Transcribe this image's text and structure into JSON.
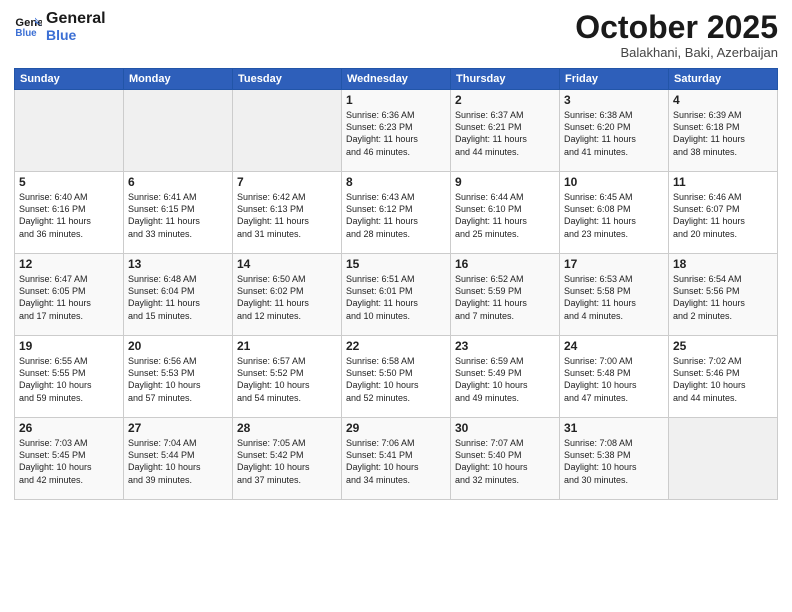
{
  "logo": {
    "line1": "General",
    "line2": "Blue"
  },
  "title": "October 2025",
  "subtitle": "Balakhani, Baki, Azerbaijan",
  "days_header": [
    "Sunday",
    "Monday",
    "Tuesday",
    "Wednesday",
    "Thursday",
    "Friday",
    "Saturday"
  ],
  "weeks": [
    [
      {
        "day": "",
        "info": ""
      },
      {
        "day": "",
        "info": ""
      },
      {
        "day": "",
        "info": ""
      },
      {
        "day": "1",
        "info": "Sunrise: 6:36 AM\nSunset: 6:23 PM\nDaylight: 11 hours\nand 46 minutes."
      },
      {
        "day": "2",
        "info": "Sunrise: 6:37 AM\nSunset: 6:21 PM\nDaylight: 11 hours\nand 44 minutes."
      },
      {
        "day": "3",
        "info": "Sunrise: 6:38 AM\nSunset: 6:20 PM\nDaylight: 11 hours\nand 41 minutes."
      },
      {
        "day": "4",
        "info": "Sunrise: 6:39 AM\nSunset: 6:18 PM\nDaylight: 11 hours\nand 38 minutes."
      }
    ],
    [
      {
        "day": "5",
        "info": "Sunrise: 6:40 AM\nSunset: 6:16 PM\nDaylight: 11 hours\nand 36 minutes."
      },
      {
        "day": "6",
        "info": "Sunrise: 6:41 AM\nSunset: 6:15 PM\nDaylight: 11 hours\nand 33 minutes."
      },
      {
        "day": "7",
        "info": "Sunrise: 6:42 AM\nSunset: 6:13 PM\nDaylight: 11 hours\nand 31 minutes."
      },
      {
        "day": "8",
        "info": "Sunrise: 6:43 AM\nSunset: 6:12 PM\nDaylight: 11 hours\nand 28 minutes."
      },
      {
        "day": "9",
        "info": "Sunrise: 6:44 AM\nSunset: 6:10 PM\nDaylight: 11 hours\nand 25 minutes."
      },
      {
        "day": "10",
        "info": "Sunrise: 6:45 AM\nSunset: 6:08 PM\nDaylight: 11 hours\nand 23 minutes."
      },
      {
        "day": "11",
        "info": "Sunrise: 6:46 AM\nSunset: 6:07 PM\nDaylight: 11 hours\nand 20 minutes."
      }
    ],
    [
      {
        "day": "12",
        "info": "Sunrise: 6:47 AM\nSunset: 6:05 PM\nDaylight: 11 hours\nand 17 minutes."
      },
      {
        "day": "13",
        "info": "Sunrise: 6:48 AM\nSunset: 6:04 PM\nDaylight: 11 hours\nand 15 minutes."
      },
      {
        "day": "14",
        "info": "Sunrise: 6:50 AM\nSunset: 6:02 PM\nDaylight: 11 hours\nand 12 minutes."
      },
      {
        "day": "15",
        "info": "Sunrise: 6:51 AM\nSunset: 6:01 PM\nDaylight: 11 hours\nand 10 minutes."
      },
      {
        "day": "16",
        "info": "Sunrise: 6:52 AM\nSunset: 5:59 PM\nDaylight: 11 hours\nand 7 minutes."
      },
      {
        "day": "17",
        "info": "Sunrise: 6:53 AM\nSunset: 5:58 PM\nDaylight: 11 hours\nand 4 minutes."
      },
      {
        "day": "18",
        "info": "Sunrise: 6:54 AM\nSunset: 5:56 PM\nDaylight: 11 hours\nand 2 minutes."
      }
    ],
    [
      {
        "day": "19",
        "info": "Sunrise: 6:55 AM\nSunset: 5:55 PM\nDaylight: 10 hours\nand 59 minutes."
      },
      {
        "day": "20",
        "info": "Sunrise: 6:56 AM\nSunset: 5:53 PM\nDaylight: 10 hours\nand 57 minutes."
      },
      {
        "day": "21",
        "info": "Sunrise: 6:57 AM\nSunset: 5:52 PM\nDaylight: 10 hours\nand 54 minutes."
      },
      {
        "day": "22",
        "info": "Sunrise: 6:58 AM\nSunset: 5:50 PM\nDaylight: 10 hours\nand 52 minutes."
      },
      {
        "day": "23",
        "info": "Sunrise: 6:59 AM\nSunset: 5:49 PM\nDaylight: 10 hours\nand 49 minutes."
      },
      {
        "day": "24",
        "info": "Sunrise: 7:00 AM\nSunset: 5:48 PM\nDaylight: 10 hours\nand 47 minutes."
      },
      {
        "day": "25",
        "info": "Sunrise: 7:02 AM\nSunset: 5:46 PM\nDaylight: 10 hours\nand 44 minutes."
      }
    ],
    [
      {
        "day": "26",
        "info": "Sunrise: 7:03 AM\nSunset: 5:45 PM\nDaylight: 10 hours\nand 42 minutes."
      },
      {
        "day": "27",
        "info": "Sunrise: 7:04 AM\nSunset: 5:44 PM\nDaylight: 10 hours\nand 39 minutes."
      },
      {
        "day": "28",
        "info": "Sunrise: 7:05 AM\nSunset: 5:42 PM\nDaylight: 10 hours\nand 37 minutes."
      },
      {
        "day": "29",
        "info": "Sunrise: 7:06 AM\nSunset: 5:41 PM\nDaylight: 10 hours\nand 34 minutes."
      },
      {
        "day": "30",
        "info": "Sunrise: 7:07 AM\nSunset: 5:40 PM\nDaylight: 10 hours\nand 32 minutes."
      },
      {
        "day": "31",
        "info": "Sunrise: 7:08 AM\nSunset: 5:38 PM\nDaylight: 10 hours\nand 30 minutes."
      },
      {
        "day": "",
        "info": ""
      }
    ]
  ]
}
